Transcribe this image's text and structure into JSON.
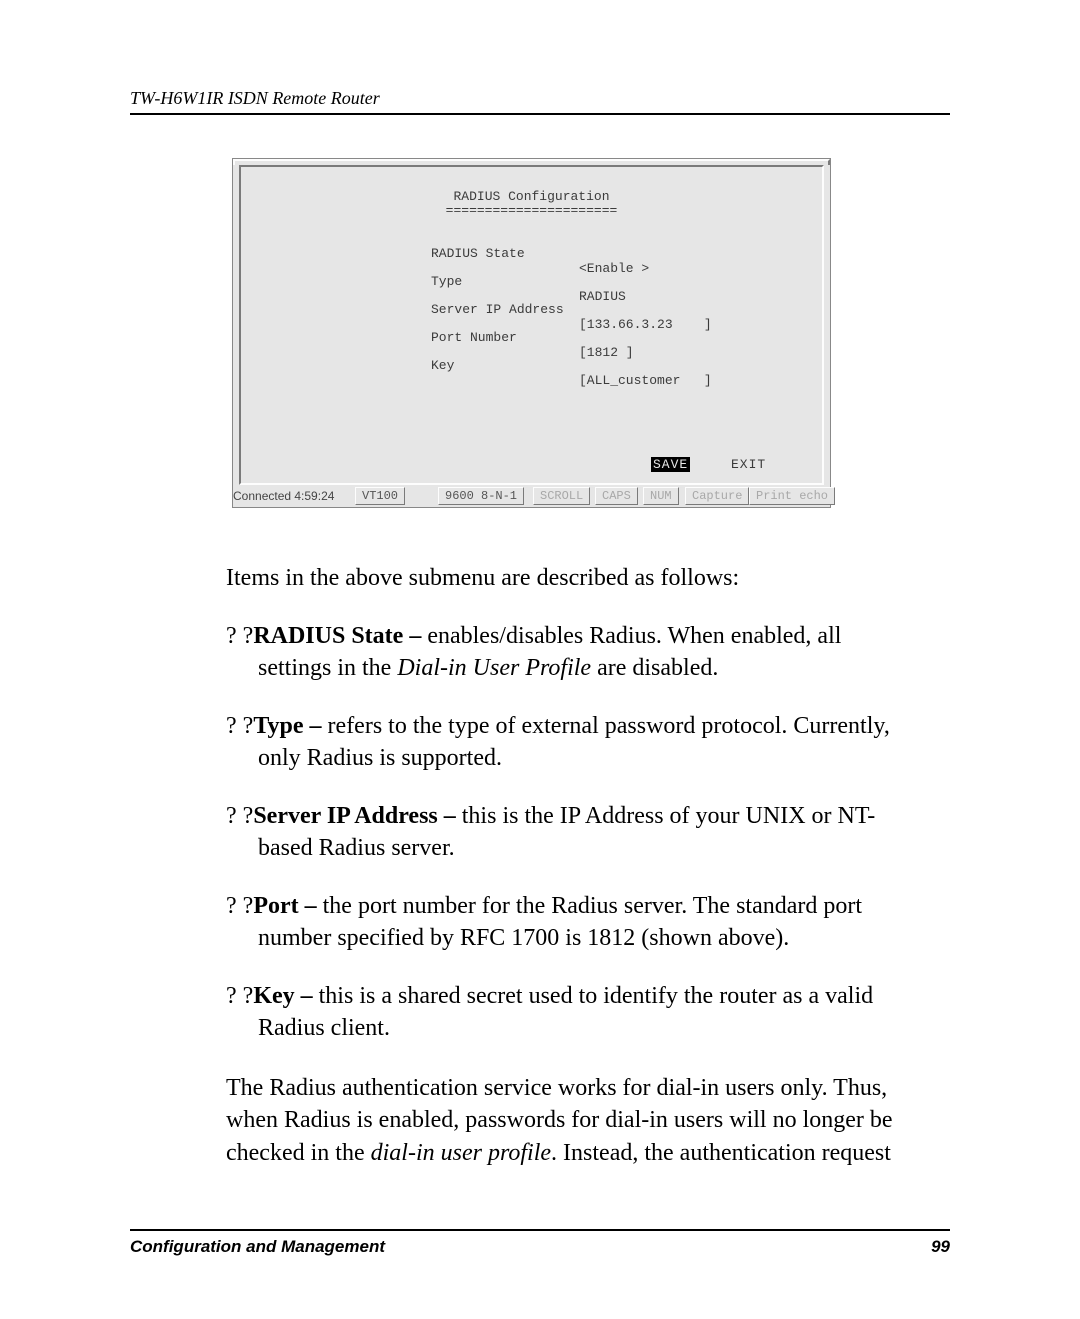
{
  "header": {
    "title": "TW-H6W1IR ISDN Remote Router"
  },
  "terminal": {
    "title": "RADIUS Configuration",
    "underline": "======================",
    "rows": [
      {
        "label": "RADIUS State",
        "value": "<Enable >"
      },
      {
        "label": "Type",
        "value": "RADIUS"
      },
      {
        "label": "Server IP Address",
        "value": "[133.66.3.23    ]"
      },
      {
        "label": "Port Number",
        "value": "[1812 ]"
      },
      {
        "label": "Key",
        "value": "[ALL_customer   ]"
      }
    ],
    "save": "SAVE",
    "exit": "EXIT",
    "status": {
      "connected": "Connected 4:59:24",
      "term": "VT100",
      "baud": "9600 8-N-1",
      "scroll": "SCROLL",
      "caps": "CAPS",
      "num": "NUM",
      "capture": "Capture",
      "print": "Print echo"
    }
  },
  "intro": "Items in the above submenu are described as follows:",
  "items": [
    {
      "q": "? ?",
      "bold": "RADIUS State – ",
      "rest1": "enables/disables Radius. When enabled, all",
      "cont": "settings in the ",
      "italic": "Dial-in User Profile",
      "tail": " are disabled."
    },
    {
      "q": "? ?",
      "bold": "Type – ",
      "rest1": "refers to the type of external password protocol. Currently,",
      "cont": "only Radius is supported.",
      "italic": "",
      "tail": ""
    },
    {
      "q": "? ?",
      "bold": "Server IP Address – ",
      "rest1": "this is the IP Address of your UNIX or NT-",
      "cont": "based Radius server.",
      "italic": "",
      "tail": ""
    },
    {
      "q": "? ?",
      "bold": "Port – ",
      "rest1": "the port number for the Radius server. The standard port",
      "cont": "number specified by RFC 1700 is 1812 (shown above).",
      "italic": "",
      "tail": ""
    },
    {
      "q": "? ?",
      "bold": "Key – ",
      "rest1": "this is a shared secret used to identify the router as a valid",
      "cont": "Radius client.",
      "italic": "",
      "tail": ""
    }
  ],
  "para": {
    "l1": "The Radius authentication service works for dial-in users only. Thus,",
    "l2": "when Radius is enabled, passwords  for dial-in users will no longer be",
    "l3a": "checked in the ",
    "l3i": "dial-in user profile",
    "l3b": ". Instead, the authentication request"
  },
  "footer": {
    "left": "Configuration and Management",
    "right": "99"
  }
}
